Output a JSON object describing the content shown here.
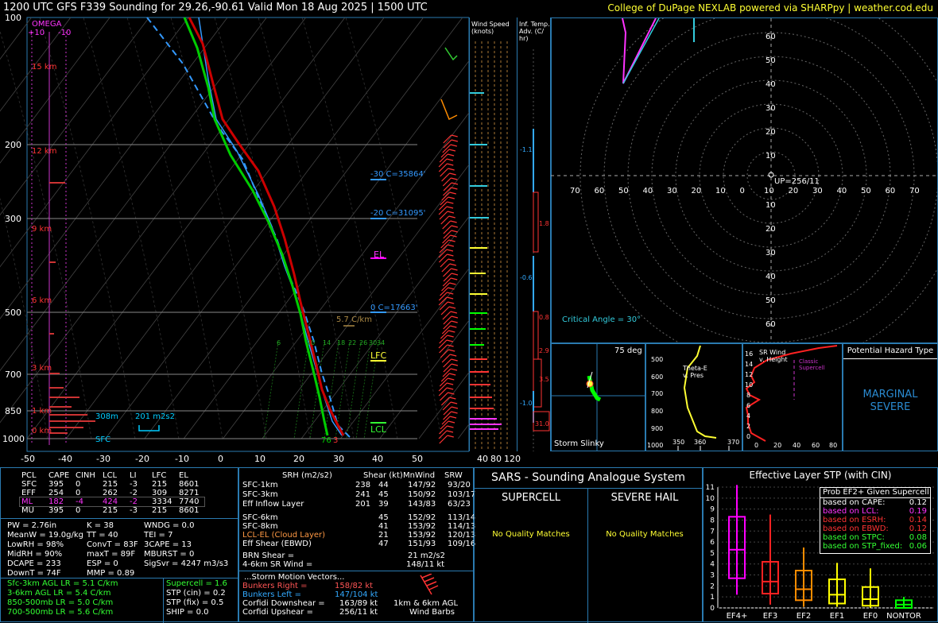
{
  "header": {
    "title": "1200 UTC GFS F339 Sounding for 29.26,-90.61 Valid  Mon 18 Aug 2025 | 1500 UTC",
    "credit": "College of DuPage NEXLAB powered via SHARPpy | weather.cod.edu"
  },
  "skewt": {
    "pressure_ticks": [
      "100",
      "200",
      "300",
      "500",
      "700",
      "850",
      "1000"
    ],
    "temp_ticks": [
      "-50",
      "-40",
      "-30",
      "-20",
      "-10",
      "0",
      "10",
      "20",
      "30",
      "40",
      "50"
    ],
    "height_labels": [
      "15 km",
      "12 km",
      "9 km",
      "6 km",
      "3 km",
      "1 km",
      "0 km"
    ],
    "omega_label": "OMEGA",
    "omega_ticks": [
      "+10",
      "-10"
    ],
    "freezing_labels": [
      "-30 C=35864'",
      "-20 C=31095'",
      "0 C=17663'"
    ],
    "el_label": "EL",
    "lfc_label": "LFC",
    "lcl_label": "LCL",
    "lapse_label": "5.7 C/km",
    "mixing_labels": [
      "6",
      "10",
      "14",
      "18",
      "22",
      "26",
      "30",
      "34"
    ],
    "eff_inflow_depth": "308m",
    "eff_inflow_srh": "201 m2s2",
    "sfc_label": "SFC",
    "sfc_td": "76",
    "sfc_t": "3"
  },
  "wind_speed_panel": {
    "title1": "Wind Speed",
    "title2": "(knots)",
    "ticks": [
      "40",
      "80",
      "120"
    ]
  },
  "temp_adv_panel": {
    "title1": "Inf. Temp.",
    "title2": "Adv. (C/",
    "title3": "hr)",
    "values": [
      "-1.1",
      "1.8",
      "-0.6",
      "0.8",
      "2.9",
      "3.5",
      "-1.0",
      "31.0"
    ]
  },
  "hodograph": {
    "rings_y": [
      "60",
      "50",
      "40",
      "30",
      "20",
      "10"
    ],
    "rings_x": [
      "70",
      "60",
      "50",
      "40",
      "30",
      "20",
      "10",
      "0",
      "10",
      "20",
      "30",
      "40",
      "50",
      "60",
      "70"
    ],
    "rings_y_bottom": [
      "10",
      "20",
      "30",
      "40",
      "50",
      "60"
    ],
    "up_label": "UP=256/11",
    "critical_angle": "Critical Angle = 30°"
  },
  "slinky": {
    "title": "75 deg",
    "label": "Storm Slinky"
  },
  "theta_e": {
    "label": "Theta-E v. Pres",
    "y_ticks": [
      "500",
      "600",
      "700",
      "800",
      "900",
      "1000"
    ],
    "x_ticks": [
      "350",
      "360",
      "370"
    ]
  },
  "srwind": {
    "label": "SR Wind v. Height",
    "classic": "Classic Supercell",
    "y_ticks": [
      "16",
      "14",
      "12",
      "10",
      "8",
      "6",
      "4",
      "2",
      "0"
    ],
    "x_ticks": [
      "0",
      "20",
      "40",
      "60",
      "80"
    ]
  },
  "hazard": {
    "title": "Potential Hazard Type",
    "value_line1": "MARGINAL",
    "value_line2": "SEVERE"
  },
  "parcels": {
    "headers": [
      "PCL",
      "CAPE",
      "CINH",
      "LCL",
      "LI",
      "LFC",
      "EL"
    ],
    "rows": [
      [
        "SFC",
        "395",
        "0",
        "215",
        "-3",
        "215",
        "8601"
      ],
      [
        "EFF",
        "254",
        "0",
        "262",
        "-2",
        "309",
        "8271"
      ],
      [
        "ML",
        "182",
        "-4",
        "424",
        "-2",
        "3334",
        "7740"
      ],
      [
        "MU",
        "395",
        "0",
        "215",
        "-3",
        "215",
        "8601"
      ]
    ]
  },
  "thermo": {
    "col1": [
      "PW = 2.76in",
      "MeanW = 19.0g/kg",
      "LowRH = 98%",
      "MidRH = 90%",
      "DCAPE = 233",
      "DownT = 74F"
    ],
    "col2": [
      "K = 38",
      "TT = 40",
      "ConvT = 83F",
      "maxT = 89F",
      "ESP = 0",
      "MMP = 0.89"
    ],
    "col3": [
      "WNDG = 0.0",
      "TEI = 7",
      "3CAPE = 13",
      "MBURST = 0",
      "",
      "SigSvr = 4247 m3/s3"
    ]
  },
  "lapse": {
    "rows": [
      "Sfc-3km AGL LR = 5.1 C/km",
      "3-6km AGL LR = 5.4 C/km",
      "850-500mb LR = 5.0 C/km",
      "700-500mb LR = 5.6 C/km"
    ],
    "composites": [
      "Supercell = 1.6",
      "STP (cin) = 0.2",
      "STP (fix) = 0.5",
      "SHIP = 0.0"
    ]
  },
  "kinematics": {
    "headers": [
      "SRH (m2/s2)",
      "Shear (kt)",
      "MnWind",
      "SRW"
    ],
    "rows1": [
      [
        "SFC-1km",
        "238",
        "44",
        "147/92",
        "93/20"
      ],
      [
        "SFC-3km",
        "241",
        "45",
        "150/92",
        "103/17"
      ],
      [
        "Eff Inflow Layer",
        "201",
        "39",
        "143/83",
        "63/23"
      ]
    ],
    "rows2": [
      [
        "SFC-6km",
        "",
        "45",
        "152/92",
        "113/14"
      ],
      [
        "SFC-8km",
        "",
        "41",
        "153/92",
        "114/13"
      ],
      [
        "LCL-EL (Cloud Layer)",
        "",
        "21",
        "153/92",
        "120/13"
      ],
      [
        "Eff Shear (EBWD)",
        "",
        "47",
        "151/93",
        "109/16"
      ]
    ],
    "brn_shear": [
      "BRN Shear =",
      "21 m2/s2"
    ],
    "sr_wind": [
      "4-6km SR Wind =",
      "148/11 kt"
    ],
    "storm_title": "...Storm Motion Vectors...",
    "motions": [
      [
        "Bunkers Right =",
        "158/82 kt"
      ],
      [
        "Bunkers Left =",
        "147/104 kt"
      ],
      [
        "Corfidi Downshear =",
        "163/89 kt"
      ],
      [
        "Corfidi Upshear =",
        "256/11 kt"
      ]
    ],
    "barb_label1": "1km & 6km AGL",
    "barb_label2": "Wind Barbs"
  },
  "sars": {
    "title": "SARS - Sounding Analogue System",
    "supercell": "SUPERCELL",
    "hail": "SEVERE HAIL",
    "no_match": "No Quality Matches"
  },
  "stp": {
    "title": "Effective Layer STP (with CIN)",
    "legend_title": "Prob EF2+ Given Supercell",
    "legend_rows": [
      [
        "based on CAPE:",
        "0.12",
        "#ffffff"
      ],
      [
        "based on LCL:",
        "0.19",
        "#ff33ff"
      ],
      [
        "based on ESRH:",
        "0.14",
        "#ff3333"
      ],
      [
        "based on EBWD:",
        "0.12",
        "#ff3333"
      ],
      [
        "based on STPC:",
        "0.08",
        "#33ff33"
      ],
      [
        "based on STP_fixed:",
        "0.06",
        "#33ff33"
      ]
    ],
    "y_ticks": [
      "11",
      "10",
      "9",
      "8",
      "7",
      "6",
      "5",
      "4",
      "3",
      "2",
      "1",
      "0"
    ],
    "categories": [
      "EF4+",
      "EF3",
      "EF2",
      "EF1",
      "EF0",
      "NONTOR"
    ]
  },
  "chart_data": {
    "type": "box",
    "title": "Effective Layer STP (with CIN)",
    "categories": [
      "EF4+",
      "EF3",
      "EF2",
      "EF1",
      "EF0",
      "NONTOR"
    ],
    "boxes": [
      {
        "name": "EF4+",
        "whisker_low": 1.2,
        "q1": 2.7,
        "median": 5.3,
        "q3": 8.3,
        "whisker_high": 11.2,
        "color": "#ff00ff"
      },
      {
        "name": "EF3",
        "whisker_low": 0.3,
        "q1": 1.3,
        "median": 2.4,
        "q3": 4.2,
        "whisker_high": 8.5,
        "color": "#ff2222"
      },
      {
        "name": "EF2",
        "whisker_low": 0.1,
        "q1": 0.7,
        "median": 1.7,
        "q3": 3.4,
        "whisker_high": 5.5,
        "color": "#ff8c00"
      },
      {
        "name": "EF1",
        "whisker_low": 0.1,
        "q1": 0.4,
        "median": 1.2,
        "q3": 2.6,
        "whisker_high": 4.1,
        "color": "#ffff00"
      },
      {
        "name": "EF0",
        "whisker_low": 0.0,
        "q1": 0.2,
        "median": 0.8,
        "q3": 1.9,
        "whisker_high": 3.6,
        "color": "#ffff00"
      },
      {
        "name": "NONTOR",
        "whisker_low": 0.0,
        "q1": 0.0,
        "median": 0.3,
        "q3": 0.7,
        "whisker_high": 1.0,
        "color": "#00ff00"
      }
    ],
    "ylim": [
      0,
      11
    ]
  },
  "colors": {
    "panel_border": "#2a7ab0",
    "temp": "#cc0000",
    "dewpoint": "#00cc00",
    "wetbulb": "#33aaff",
    "accent_yellow": "#ffff33"
  }
}
